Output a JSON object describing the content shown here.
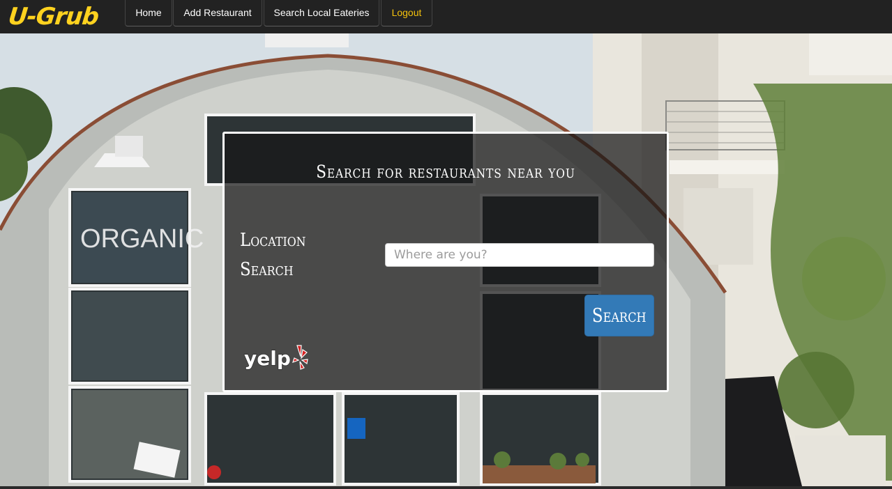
{
  "navbar": {
    "brand": "U-Grub",
    "items": [
      {
        "label": "Home"
      },
      {
        "label": "Add Restaurant"
      },
      {
        "label": "Search Local Eateries"
      },
      {
        "label": "Logout"
      }
    ]
  },
  "hero": {
    "background": "storefront-photo"
  },
  "search_panel": {
    "title": "Search for restaurants near you",
    "location_label": "Location Search",
    "input_placeholder": "Where are you?",
    "input_value": "",
    "button_label": "Search",
    "logo": "yelp-logo",
    "logo_text": "yelp"
  },
  "colors": {
    "navbar_bg": "#222222",
    "brand": "#ffd21f",
    "logout": "#f4c20d",
    "button": "#337ab7",
    "yelp_red": "#d32323"
  }
}
